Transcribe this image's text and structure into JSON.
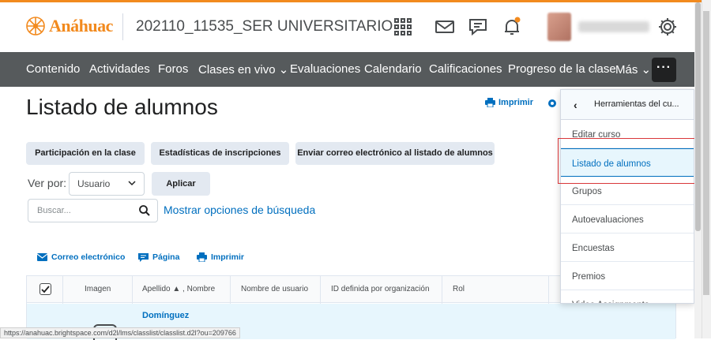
{
  "header": {
    "logo_text": "Anáhuac",
    "course_title": "202110_11535_SER UNIVERSITARIO"
  },
  "nav": {
    "items": [
      "Contenido",
      "Actividades",
      "Foros",
      "Clases en vivo",
      "Evaluaciones",
      "Calendario",
      "Calificaciones",
      "Progreso de la clase",
      "Más"
    ],
    "more_label": "···"
  },
  "page": {
    "title": "Listado de alumnos",
    "print_label": "Imprimir"
  },
  "buttons": {
    "participacion": "Participación en la clase",
    "estadisticas": "Estadísticas de inscripciones",
    "enviar_correo": "Enviar correo electrónico al listado de alumnos",
    "aplicar": "Aplicar"
  },
  "filters": {
    "ver_por_label": "Ver por:",
    "ver_por_value": "Usuario",
    "search_placeholder": "Buscar...",
    "show_options": "Mostrar opciones de búsqueda"
  },
  "actions": {
    "email": "Correo electrónico",
    "page": "Página",
    "print": "Imprimir"
  },
  "table": {
    "columns": [
      "Imagen",
      "Apellido ▲ , Nombre",
      "Nombre de usuario",
      "ID definida por organización",
      "Rol"
    ],
    "first_row_name": "Domínguez"
  },
  "dropdown": {
    "header": "Herramientas del cu...",
    "items": [
      "Editar curso",
      "Listado de alumnos",
      "Grupos",
      "Autoevaluaciones",
      "Encuestas",
      "Premios",
      "Video Assignments"
    ],
    "active_index": 1
  },
  "statusbar": {
    "url": "https://anahuac.brightspace.com/d2l/lms/classlist/classlist.d2l?ou=209766"
  },
  "colors": {
    "brand_orange": "#f28a1e",
    "link_blue": "#006fbf",
    "nav_gray": "#565a5c",
    "highlight_red": "#d9373a"
  }
}
